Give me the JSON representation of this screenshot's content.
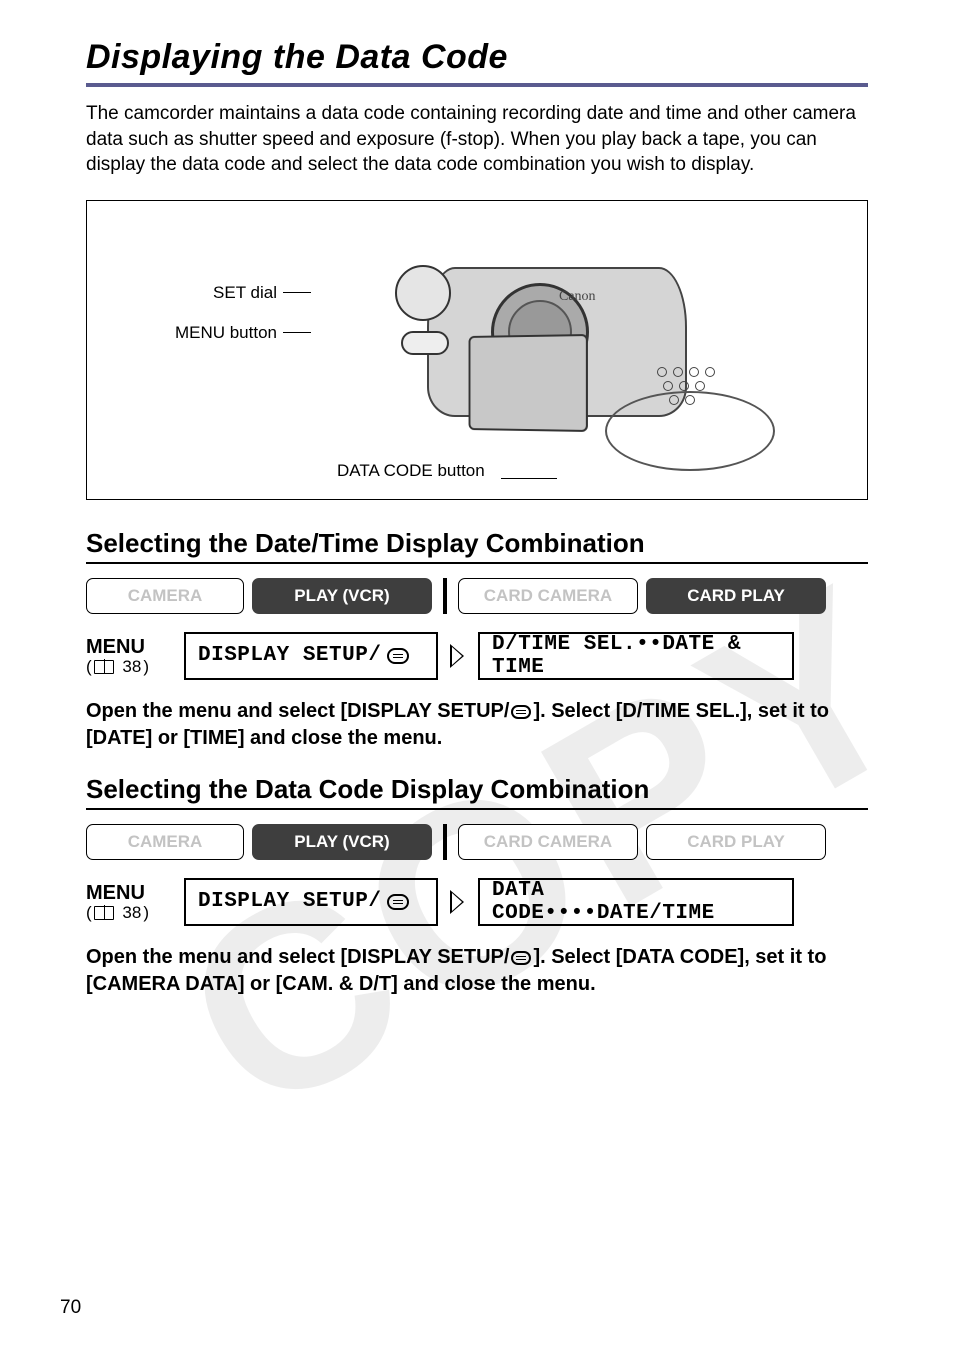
{
  "title": "Displaying the Data Code",
  "intro": "The camcorder maintains a data code containing recording date and time and other camera data such as shutter speed and exposure (f-stop). When you play back a tape, you can display the data code and select the data code combination you wish to display.",
  "diagram": {
    "set_dial": "SET dial",
    "menu_button": "MENU button",
    "data_code_button": "DATA CODE button",
    "brand": "Canon"
  },
  "section1": {
    "heading": "Selecting the Date/Time Display Combination",
    "modes": {
      "camera": "CAMERA",
      "play_vcr": "PLAY (VCR)",
      "card_camera": "CARD CAMERA",
      "card_play": "CARD PLAY"
    },
    "menu": {
      "label": "MENU",
      "ref": "38",
      "box1": "DISPLAY SETUP/",
      "box2": "D/TIME SEL.••DATE & TIME"
    },
    "instruction_a": "Open the menu and select [DISPLAY SETUP/",
    "instruction_b": "]. Select [D/TIME SEL.], set it to [DATE] or [TIME] and close the menu."
  },
  "section2": {
    "heading": "Selecting the Data Code Display Combination",
    "modes": {
      "camera": "CAMERA",
      "play_vcr": "PLAY (VCR)",
      "card_camera": "CARD CAMERA",
      "card_play": "CARD PLAY"
    },
    "menu": {
      "label": "MENU",
      "ref": "38",
      "box1": "DISPLAY SETUP/",
      "box2": "DATA CODE••••DATE/TIME"
    },
    "instruction_a": "Open the menu and select [DISPLAY SETUP/",
    "instruction_b": "]. Select [DATA CODE], set it to [CAMERA DATA] or [CAM. & D/T] and close the menu."
  },
  "page_number": "70"
}
